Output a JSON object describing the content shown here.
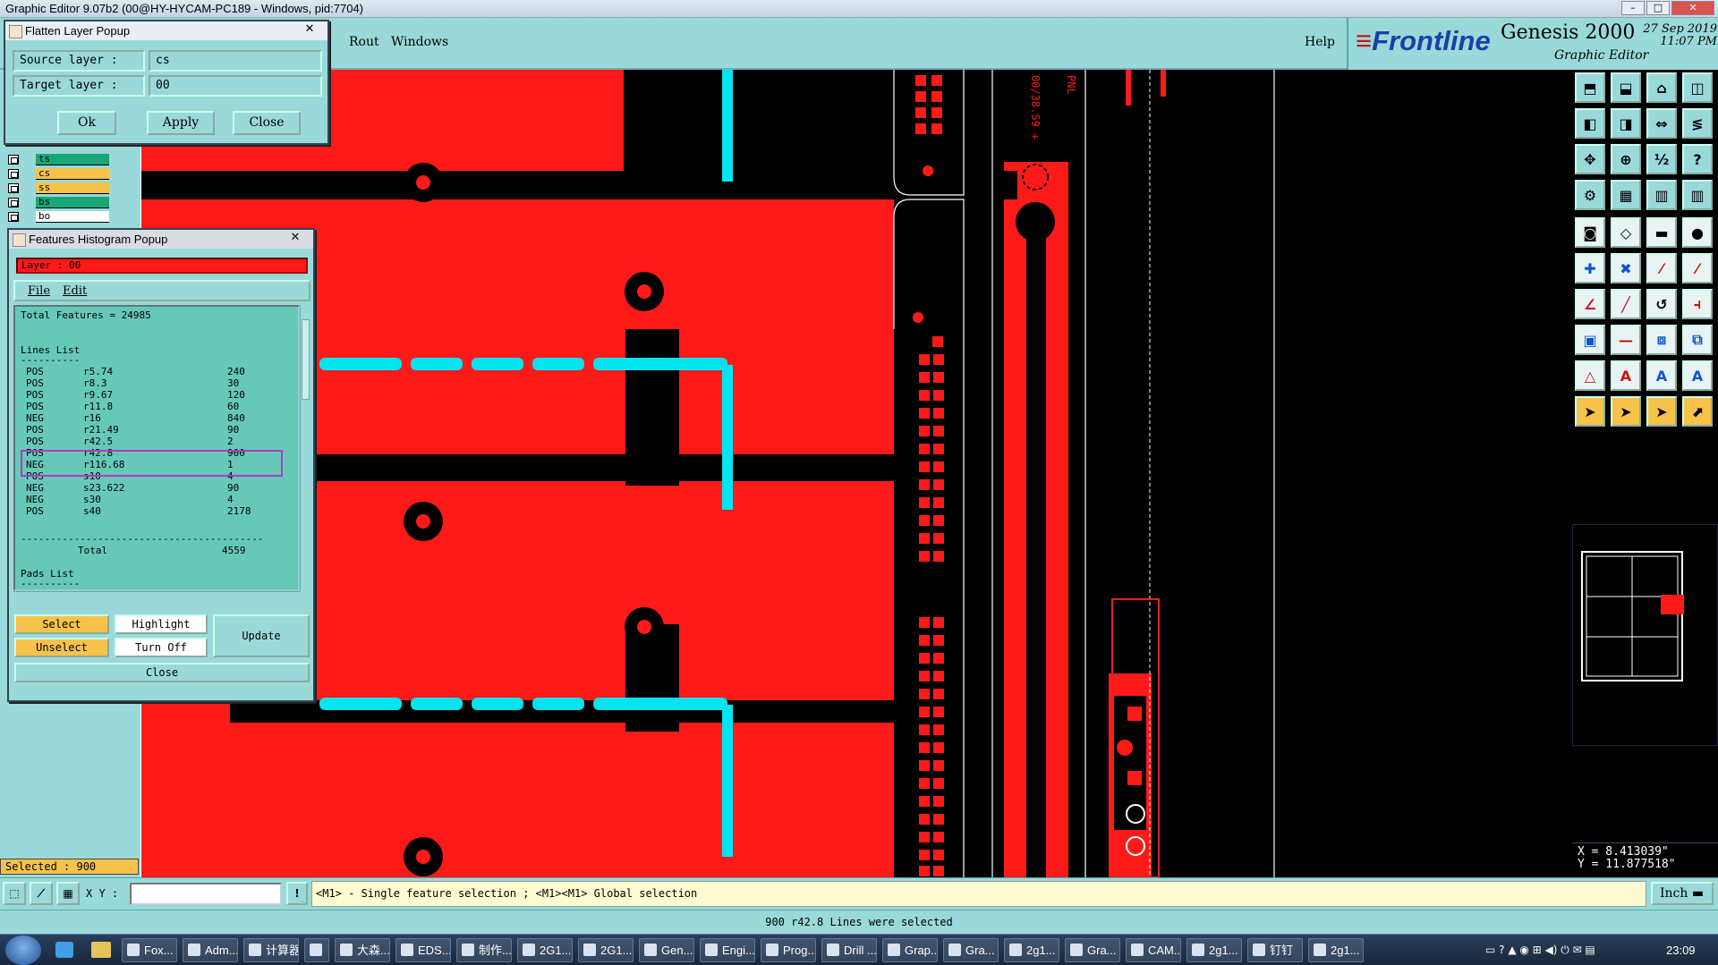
{
  "window": {
    "title": "Graphic Editor 9.07b2 (00@HY-HYCAM-PC189 - Windows, pid:7704)"
  },
  "menu": {
    "items": [
      "Rout",
      "Windows"
    ],
    "help": "Help"
  },
  "brand": {
    "logo": "Frontline",
    "product": "Genesis 2000",
    "subtitle": "Graphic Editor",
    "date": "27 Sep 2019",
    "time": "11:07 PM"
  },
  "flatten": {
    "title": "Flatten Layer Popup",
    "source_label": "Source layer :",
    "source_value": "cs",
    "target_label": "Target layer :",
    "target_value": "00",
    "ok": "Ok",
    "apply": "Apply",
    "close": "Close"
  },
  "layers": [
    {
      "name": "ts",
      "color": "#18a878"
    },
    {
      "name": "cs",
      "color": "#f6c24a"
    },
    {
      "name": "ss",
      "color": "#f6c24a"
    },
    {
      "name": "bs",
      "color": "#18a878"
    },
    {
      "name": "bo",
      "color": "#ffffff"
    }
  ],
  "histogram": {
    "title": "Features Histogram Popup",
    "layer_label": "Layer : 00",
    "menu": [
      "File",
      "Edit"
    ],
    "total_features": "Total Features = 24985",
    "lines_heading": "Lines List",
    "dash": "----------",
    "rows": [
      [
        "POS",
        "r5.74",
        "240"
      ],
      [
        "POS",
        "r8.3",
        "30"
      ],
      [
        "POS",
        "r9.67",
        "120"
      ],
      [
        "POS",
        "r11.8",
        "60"
      ],
      [
        "NEG",
        "r16",
        "840"
      ],
      [
        "POS",
        "r21.49",
        "90"
      ],
      [
        "POS",
        "r42.5",
        "2"
      ],
      [
        "POS",
        "r42.8",
        "900"
      ],
      [
        "NEG",
        "r116.68",
        "1"
      ],
      [
        "POS",
        "s10",
        "4"
      ],
      [
        "NEG",
        "s23.622",
        "90"
      ],
      [
        "NEG",
        "s30",
        "4"
      ],
      [
        "POS",
        "s40",
        "2178"
      ]
    ],
    "separator": "-----------------------------------------",
    "total_label": "Total",
    "total_value": "4559",
    "pads_heading": "Pads List",
    "select": "Select",
    "highlight": "Highlight",
    "update": "Update",
    "unselect": "Unselect",
    "turn_off": "Turn Off",
    "close": "Close"
  },
  "status": {
    "selected": "Selected : 900",
    "xy_label": "X Y :",
    "hint": "<M1> - Single feature selection ; <M1><M1> Global selection",
    "units": "Inch",
    "message": "900 r42.8 Lines were selected"
  },
  "coords": {
    "x": "X = 8.413039\"",
    "y": "Y = 11.877518\""
  },
  "canvas_text": {
    "v1": "00/38.S9 +",
    "v2": "PNL"
  },
  "taskbar": {
    "items": [
      "Fox...",
      "Adm...",
      "计算器",
      "",
      "大森...",
      "EDS...",
      "制作...",
      "2G1...",
      "2G1...",
      "Gen...",
      "Engi...",
      "Prog...",
      "Drill ...",
      "Grap...",
      "Gra...",
      "2g1...",
      "Gra...",
      "CAM...",
      "2g1...",
      "钉钉",
      "2g1..."
    ],
    "clock": "23:09"
  }
}
